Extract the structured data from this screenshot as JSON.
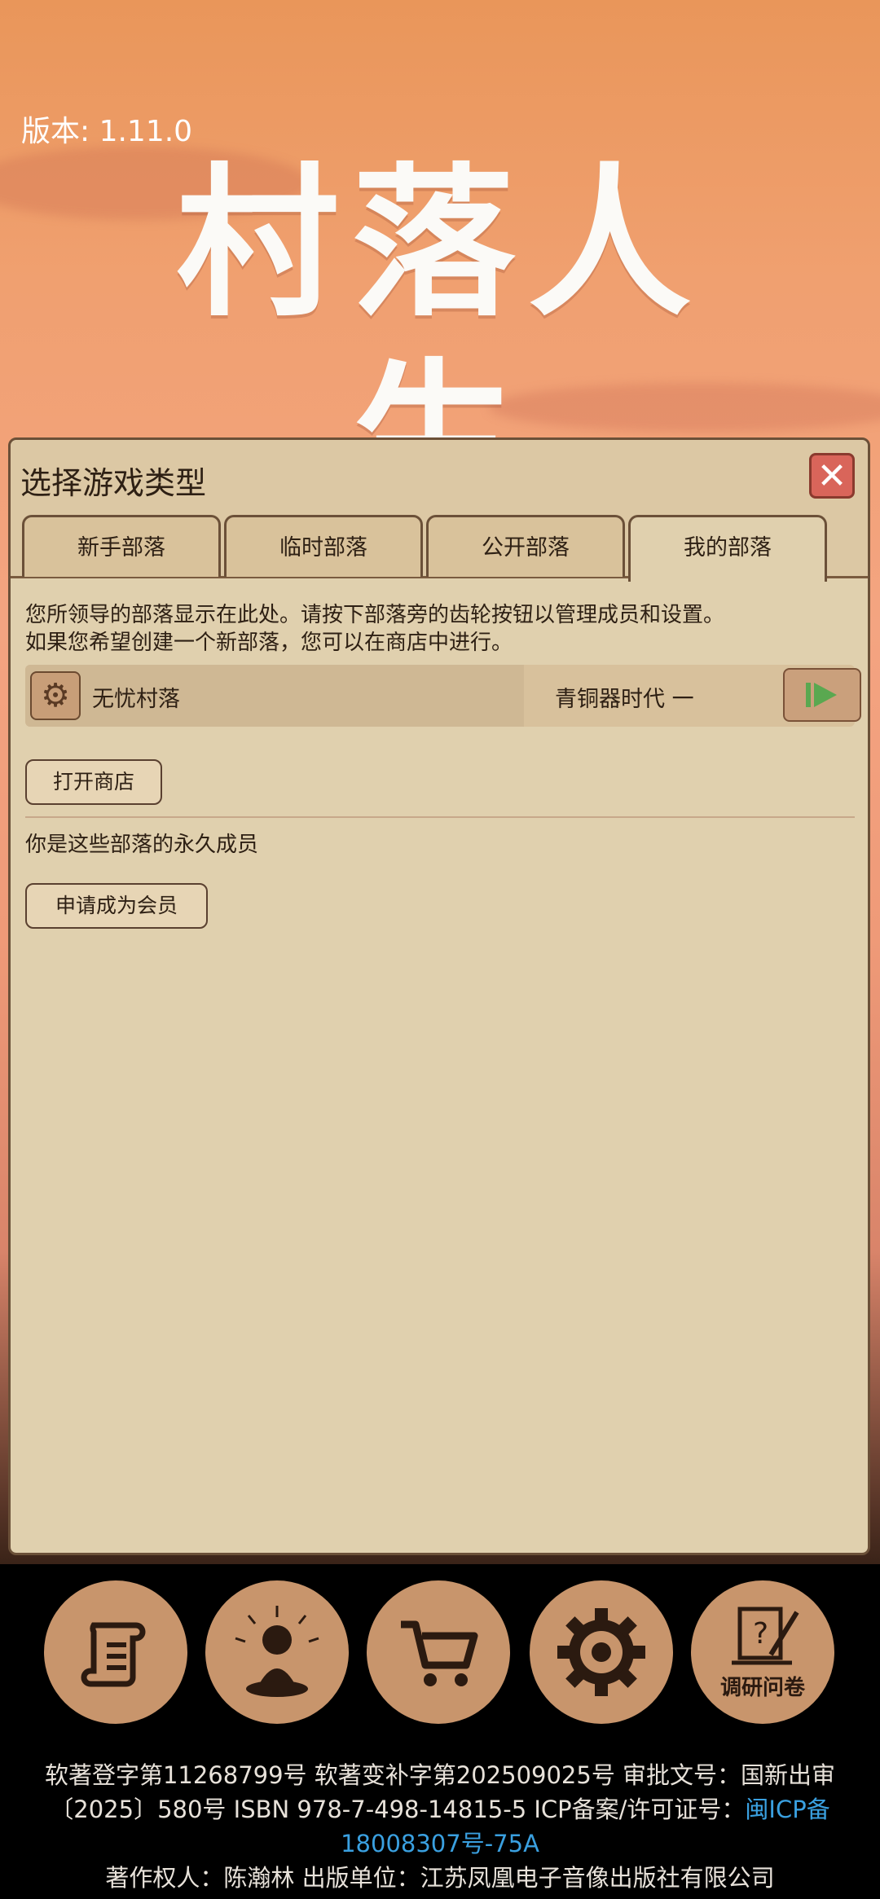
{
  "version_text": "版本: 1.11.0",
  "logo_text": "村落人生",
  "dialog": {
    "title": "选择游戏类型",
    "tabs": [
      "新手部落",
      "临时部落",
      "公开部落",
      "我的部落"
    ],
    "active_tab": "我的部落",
    "desc_line1": "您所领导的部落显示在此处。请按下部落旁的齿轮按钮以管理成员和设置。",
    "desc_line2": "如果您希望创建一个新部落，您可以在商店中进行。",
    "tribe": {
      "name": "无忧村落",
      "era": "青铜器时代 一"
    },
    "open_shop_label": "打开商店",
    "member_text": "你是这些部落的永久成员",
    "apply_member_label": "申请成为会员"
  },
  "bottom_nav": [
    {
      "icon": "scroll-icon"
    },
    {
      "icon": "meditation-icon"
    },
    {
      "icon": "cart-icon"
    },
    {
      "icon": "gear-icon"
    },
    {
      "icon": "survey-icon",
      "label": "调研问卷"
    }
  ],
  "legal": {
    "line1": "软著登字第11268799号 软著变补字第202509025号 审批文号：国新出审",
    "line2_prefix": "〔2025〕580号 ISBN 978-7-498-14815-5 ICP备案/许可证号：",
    "line2_link": "闽ICP备",
    "line3_link": "18008307号-75A",
    "line4": "著作权人：陈瀚林 出版单位：江苏凤凰电子音像出版社有限公司"
  },
  "colors": {
    "accent": "#e0d0ae",
    "close": "#d9655a",
    "link": "#3aa0e0",
    "play": "#5aa850"
  }
}
